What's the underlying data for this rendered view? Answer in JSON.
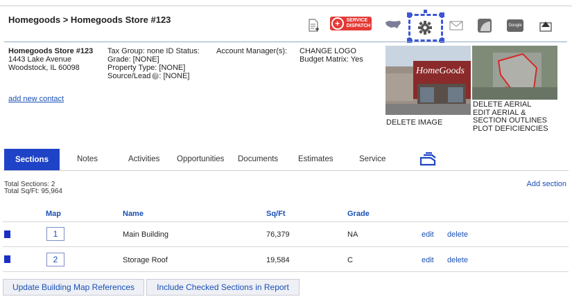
{
  "breadcrumb": "Homegoods > Homegoods Store #123",
  "toolbar": {
    "service_dispatch_line1": "SERVICE",
    "service_dispatch_line2": "DISPATCH",
    "google_label": "Google"
  },
  "store": {
    "name": "Homegoods Store #123",
    "address1": "1443 Lake Avenue",
    "address2": "Woodstock, IL 60098"
  },
  "details": {
    "tax_line": "Tax Group: none  ID Status:",
    "grade": "Grade: [NONE]",
    "property_type": "Property Type: [NONE]",
    "source_lead_label": "Source/Lead",
    "source_lead_value": ": [NONE]",
    "account_manager": "Account Manager(s):"
  },
  "logo_actions": {
    "change_logo": "CHANGE LOGO",
    "budget_matrix": "Budget Matrix: Yes"
  },
  "add_contact": "add new contact",
  "image": {
    "sign_text": "HomeGoods",
    "delete_image": "DELETE IMAGE"
  },
  "aerial": {
    "delete_aerial": "DELETE AERIAL",
    "edit_aerial": "EDIT AERIAL &",
    "section_outlines": "SECTION OUTLINES",
    "plot_deficiencies": "PLOT DEFICIENCIES"
  },
  "tabs": [
    {
      "label": "Sections"
    },
    {
      "label": "Notes"
    },
    {
      "label": "Activities"
    },
    {
      "label": "Opportunities"
    },
    {
      "label": "Documents"
    },
    {
      "label": "Estimates"
    },
    {
      "label": "Service"
    }
  ],
  "summary": {
    "total_sections": "Total Sections: 2",
    "total_sqft": "Total Sq/Ft: 95,964"
  },
  "add_section": "Add section",
  "table": {
    "headers": {
      "map": "Map",
      "name": "Name",
      "sqft": "Sq/Ft",
      "grade": "Grade"
    },
    "rows": [
      {
        "map": "1",
        "name": "Main Building",
        "sqft": "76,379",
        "grade": "NA",
        "edit": "edit",
        "delete": "delete"
      },
      {
        "map": "2",
        "name": "Storage Roof",
        "sqft": "19,584",
        "grade": "C",
        "edit": "edit",
        "delete": "delete"
      }
    ]
  },
  "buttons": {
    "update_map": "Update Building Map References",
    "include_checked": "Include Checked Sections in Report"
  },
  "colors": {
    "accent": "#1f43c7",
    "link": "#1a4fb4",
    "service_red": "#e53935"
  }
}
